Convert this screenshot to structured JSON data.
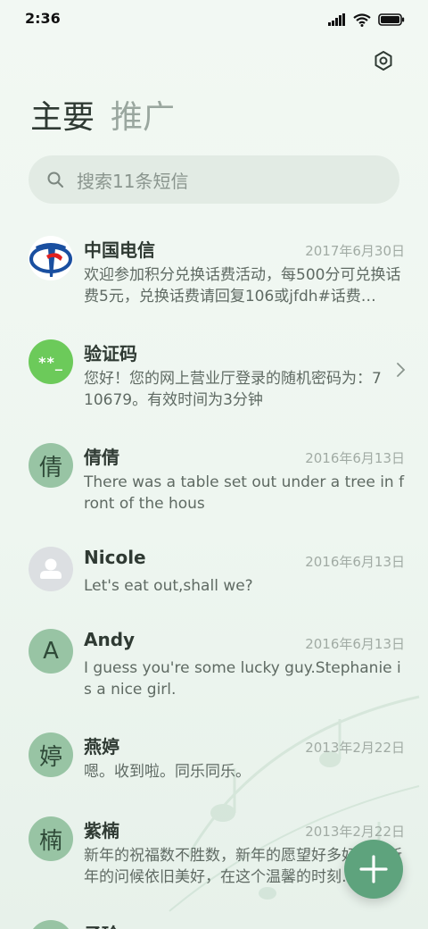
{
  "status": {
    "time": "2:36"
  },
  "tabs": [
    "主要",
    "推广"
  ],
  "search": {
    "placeholder": "搜索11条短信"
  },
  "messages": [
    {
      "name": "中国电信",
      "date": "2017年6月30日",
      "snippet": "欢迎参加积分兑换话费活动，每500分可兑换话费5元，兑换话费请回复106或jfdh#话费…",
      "avatar": "logo"
    },
    {
      "name": "验证码",
      "date": "",
      "snippet": "您好！您的网上营业厅登录的随机密码为：710679。有效时间为3分钟",
      "avatar": "**_"
    },
    {
      "name": "倩倩",
      "date": "2016年6月13日",
      "snippet": "There was a table set out under a tree in front of the hous",
      "avatar": "倩"
    },
    {
      "name": "Nicole",
      "date": "2016年6月13日",
      "snippet": "Let's eat out,shall we?",
      "avatar": "person"
    },
    {
      "name": "Andy",
      "date": "2016年6月13日",
      "snippet": "I guess you're some lucky guy.Stephanie is a nice girl.",
      "avatar": "A"
    },
    {
      "name": "燕婷",
      "date": "2013年2月22日",
      "snippet": "嗯。收到啦。同乐同乐。",
      "avatar": "婷"
    },
    {
      "name": "紫楠",
      "date": "2013年2月22日",
      "snippet": "新年的祝福数不胜数，新年的愿望好多好多，新年的问候依旧美好，在这个温馨的时刻…",
      "avatar": "楠"
    },
    {
      "name": "子玲",
      "date": "",
      "snippet": "",
      "avatar": "玲"
    }
  ],
  "colors": {
    "accent": "#5ea37d",
    "avatar_bg": "#98c4a4",
    "code_avatar": "#6cca5a"
  }
}
